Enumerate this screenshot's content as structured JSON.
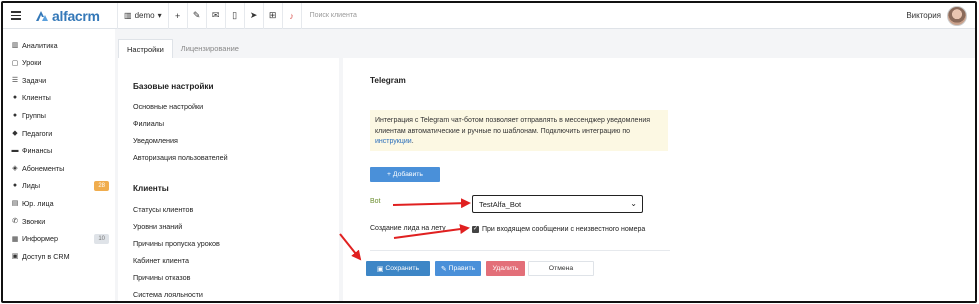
{
  "topbar": {
    "logo_text": "alfacrm",
    "demo_label": "demo",
    "search_placeholder": "Поиск клиента",
    "user_name": "Виктория"
  },
  "sidebar": {
    "items": [
      {
        "label": "Аналитика",
        "icon": "analytics-icon",
        "glyph": "▥"
      },
      {
        "label": "Уроки",
        "icon": "lessons-icon",
        "glyph": "▢"
      },
      {
        "label": "Задачи",
        "icon": "tasks-icon",
        "glyph": "☰"
      },
      {
        "label": "Клиенты",
        "icon": "client-icon",
        "glyph": "●"
      },
      {
        "label": "Группы",
        "icon": "groups-icon",
        "glyph": "●"
      },
      {
        "label": "Педагоги",
        "icon": "teachers-icon",
        "glyph": "◆"
      },
      {
        "label": "Финансы",
        "icon": "finance-icon",
        "glyph": "▬"
      },
      {
        "label": "Абонементы",
        "icon": "subscriptions-icon",
        "glyph": "◈"
      },
      {
        "label": "Лиды",
        "icon": "leads-icon",
        "glyph": "●",
        "badge": "28",
        "badge_color": "orange"
      },
      {
        "label": "Юр. лица",
        "icon": "legal-entities-icon",
        "glyph": "▤"
      },
      {
        "label": "Звонки",
        "icon": "calls-icon",
        "glyph": "✆"
      },
      {
        "label": "Информер",
        "icon": "informer-icon",
        "glyph": "▦",
        "badge": "10",
        "badge_color": "gray"
      },
      {
        "label": "Доступ в CRM",
        "icon": "lock-icon",
        "glyph": "▣"
      }
    ]
  },
  "tabs": [
    {
      "label": "Настройки",
      "active": true
    },
    {
      "label": "Лицензирование",
      "active": false
    }
  ],
  "menu": {
    "basic_heading": "Базовые настройки",
    "basic_links": [
      "Основные настройки",
      "Филиалы",
      "Уведомления",
      "Авторизация пользователей"
    ],
    "clients_heading": "Клиенты",
    "clients_links": [
      "Статусы клиентов",
      "Уровни знаний",
      "Причины пропуска уроков",
      "Кабинет клиента",
      "Причины отказов",
      "Система лояльности"
    ]
  },
  "content": {
    "title": "Telegram",
    "info_text": "Интеграция с Telegram чат-ботом позволяет отправлять в мессенджер уведомления клиентам автоматические и ручные по шаблонам. Подключить интеграцию по ",
    "info_link": "инструкции",
    "info_end": ".",
    "add_button": "+ Добавить",
    "bot_label": "Bot",
    "bot_value": "TestAlfa_Bot",
    "lead_label": "Создание лида на лету",
    "lead_checkbox_label": "При входящем сообщении с неизвестного номера",
    "lead_checked": true,
    "save_button": "Сохранить",
    "edit_button": "Править",
    "delete_button": "Удалить",
    "cancel_button": "Отмена"
  },
  "colors": {
    "brand": "#3478b8",
    "arrow": "#e02020",
    "info_bg": "#fcf8e3",
    "primary_button": "#4a90d9",
    "danger_button": "#e36f79"
  }
}
